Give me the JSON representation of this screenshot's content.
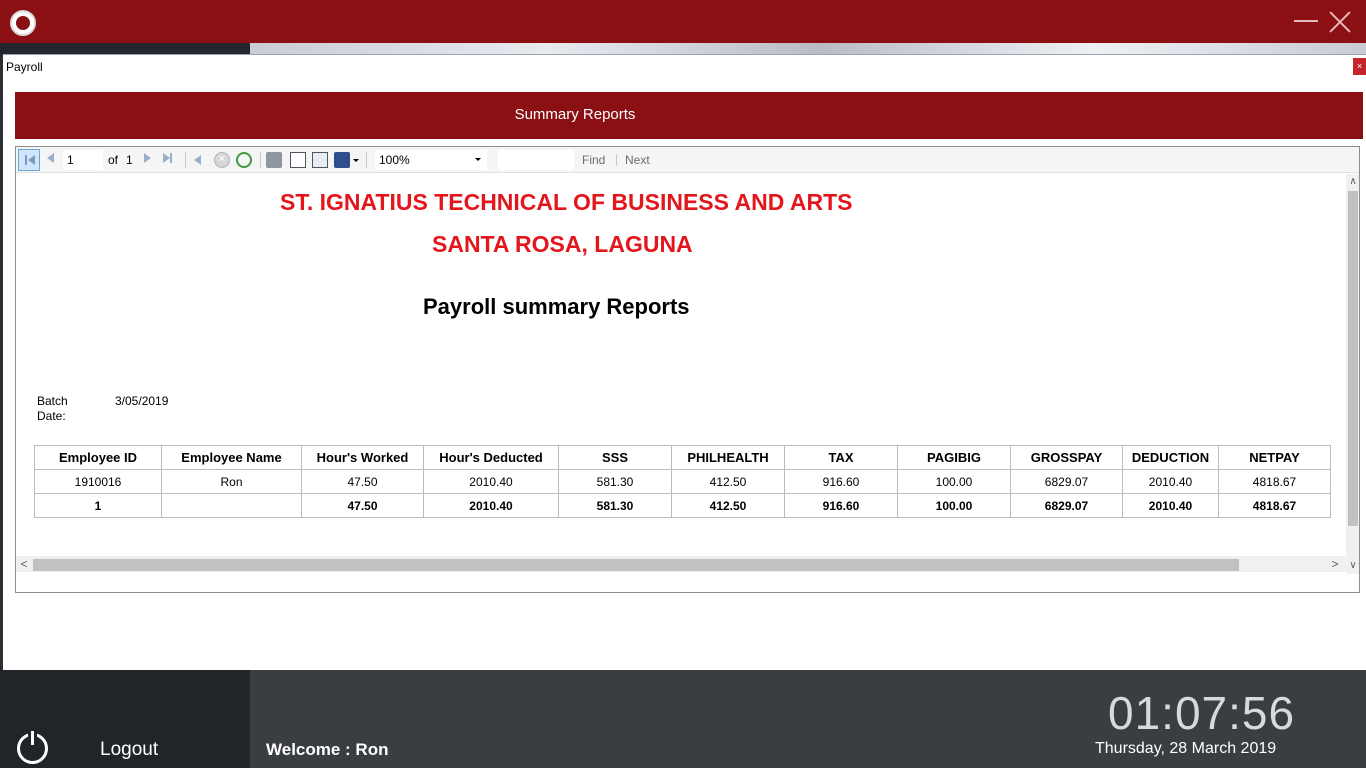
{
  "window": {
    "dialog_title": "Payroll",
    "dialog_close": "×"
  },
  "banner": {
    "title": "Summary Reports"
  },
  "toolbar": {
    "page_current": "1",
    "of_label": "of",
    "page_total": "1",
    "zoom": "100%",
    "find_label": "Find",
    "next_label": "Next",
    "stop_glyph": "✕"
  },
  "report": {
    "school": "ST. IGNATIUS TECHNICAL OF BUSINESS AND ARTS",
    "location": "SANTA ROSA, LAGUNA",
    "title": "Payroll summary Reports",
    "batch_label": "Batch Date:",
    "batch_value": "3/05/2019",
    "columns": [
      "Employee ID",
      "Employee Name",
      "Hour's Worked",
      "Hour's Deducted",
      "SSS",
      "PHILHEALTH",
      "TAX",
      "PAGIBIG",
      "GROSSPAY",
      "DEDUCTION",
      "NETPAY"
    ],
    "rows": [
      [
        "1910016",
        "Ron",
        "47.50",
        "2010.40",
        "581.30",
        "412.50",
        "916.60",
        "100.00",
        "6829.07",
        "2010.40",
        "4818.67"
      ]
    ],
    "totals": [
      "1",
      "",
      "47.50",
      "2010.40",
      "581.30",
      "412.50",
      "916.60",
      "100.00",
      "6829.07",
      "2010.40",
      "4818.67"
    ]
  },
  "scroll": {
    "up": "∧",
    "down": "∨",
    "left": "<",
    "right": ">"
  },
  "footer": {
    "logout": "Logout",
    "welcome": "Welcome : Ron",
    "clock": "01:07:56",
    "date": "Thursday, 28 March 2019"
  },
  "colors": {
    "brand": "#8b1014",
    "report_heading": "#e3161c"
  }
}
